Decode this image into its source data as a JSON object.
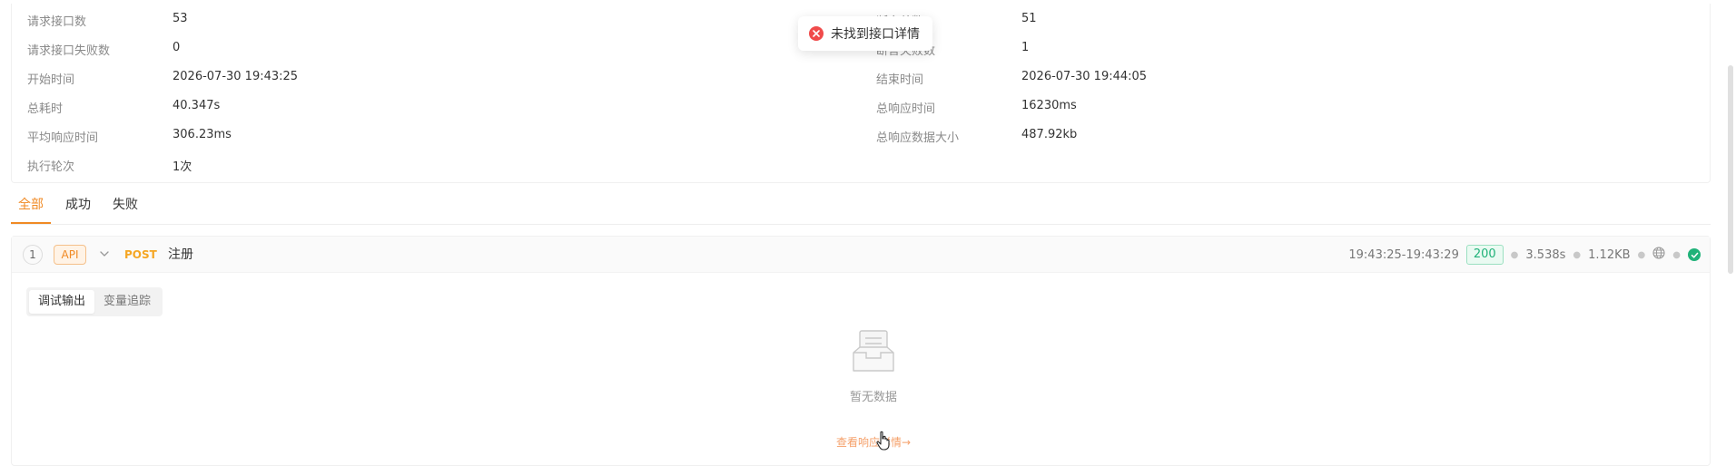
{
  "summary": {
    "left": [
      {
        "label": "请求接口数",
        "value": "53"
      },
      {
        "label": "请求接口失败数",
        "value": "0"
      },
      {
        "label": "开始时间",
        "value": "2026-07-30 19:43:25"
      },
      {
        "label": "总耗时",
        "value": "40.347s"
      },
      {
        "label": "平均响应时间",
        "value": "306.23ms"
      },
      {
        "label": "执行轮次",
        "value": "1次"
      }
    ],
    "right": [
      {
        "label": "断言总数",
        "value": "51"
      },
      {
        "label": "断言失败数",
        "value": "1"
      },
      {
        "label": "结束时间",
        "value": "2026-07-30 19:44:05"
      },
      {
        "label": "总响应时间",
        "value": "16230ms"
      },
      {
        "label": "总响应数据大小",
        "value": "487.92kb"
      }
    ]
  },
  "toast": {
    "message": "未找到接口详情",
    "icon": "error-circle-icon",
    "color": "#f04b4b"
  },
  "tabs": [
    {
      "label": "全部",
      "active": true
    },
    {
      "label": "成功",
      "active": false
    },
    {
      "label": "失败",
      "active": false
    }
  ],
  "request": {
    "index": "1",
    "type_badge": "API",
    "method": "POST",
    "name": "注册",
    "time_range": "19:43:25-19:43:29",
    "status_code": "200",
    "duration": "3.538s",
    "size": "1.12KB",
    "network_icon": "globe-icon",
    "result_icon": "check-circle-icon"
  },
  "detail_tabs": [
    {
      "label": "调试输出",
      "active": true
    },
    {
      "label": "变量追踪",
      "active": false
    }
  ],
  "empty": {
    "text": "暂无数据",
    "link": "查看响应详情→"
  },
  "colors": {
    "accent": "#f08a24",
    "success": "#20b279",
    "error": "#f04b4b"
  }
}
